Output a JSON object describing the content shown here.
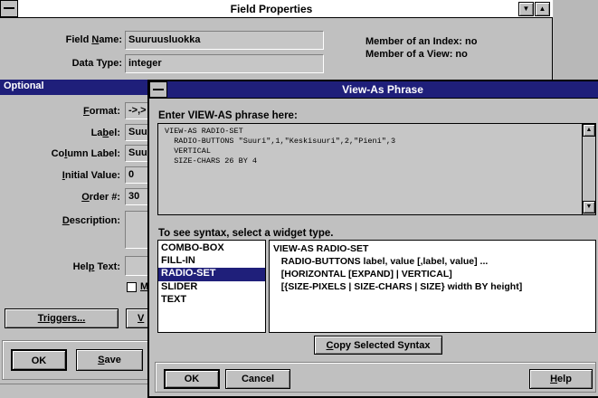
{
  "field_properties": {
    "title": "Field Properties",
    "field_name_label_pre": "Field ",
    "field_name_label_u": "N",
    "field_name_label_post": "ame:",
    "field_name_value": "Suuruusluokka",
    "data_type_label": "Data Type:",
    "data_type_value": "integer",
    "member_index": "Member of an Index: no",
    "member_view": "Member of a View: no",
    "optional_header": "Optional",
    "format_label": "Format:",
    "format_value": "->,>",
    "label_label": "Label:",
    "label_value": "Suu",
    "column_label_label": "Column Label:",
    "column_label_value": "Suu",
    "initial_value_label": "Initial Value:",
    "initial_value_value": "0",
    "order_label": "Order #:",
    "order_value": "30",
    "description_label": "Description:",
    "help_text_label": "Help Text:",
    "mandatory_partial": "M",
    "triggers_button": "Triggers...",
    "view_as_partial": "V",
    "ok_button": "OK",
    "save_button": "Save"
  },
  "view_as_phrase": {
    "title": "View-As Phrase",
    "prompt": "Enter VIEW-AS phrase here:",
    "phrase_lines": [
      "VIEW-AS RADIO-SET",
      "  RADIO-BUTTONS \"Suuri\",1,\"Keskisuuri\",2,\"Pieni\",3",
      "  VERTICAL",
      "  SIZE-CHARS 26 BY 4"
    ],
    "syntax_prompt": "To see syntax, select a widget type.",
    "widget_types": [
      "COMBO-BOX",
      "FILL-IN",
      "RADIO-SET",
      "SLIDER",
      "TEXT"
    ],
    "selected_widget": "RADIO-SET",
    "syntax_lines": [
      "VIEW-AS RADIO-SET",
      "   RADIO-BUTTONS label, value [,label, value] ...",
      "   [HORIZONTAL [EXPAND] | VERTICAL]",
      "   [{SIZE-PIXELS | SIZE-CHARS | SIZE} width BY height]"
    ],
    "copy_button": "Copy Selected Syntax",
    "ok_button": "OK",
    "cancel_button": "Cancel",
    "help_button": "Help"
  },
  "icons": {
    "minimize": "▼",
    "maximize": "▲",
    "scroll_up": "▲",
    "scroll_down": "▼"
  },
  "colors": {
    "title_active": "#1f1f7a",
    "title_inactive": "#ffffff",
    "selection": "#1f1f7a",
    "dialog_bg": "#c0c0c0"
  }
}
